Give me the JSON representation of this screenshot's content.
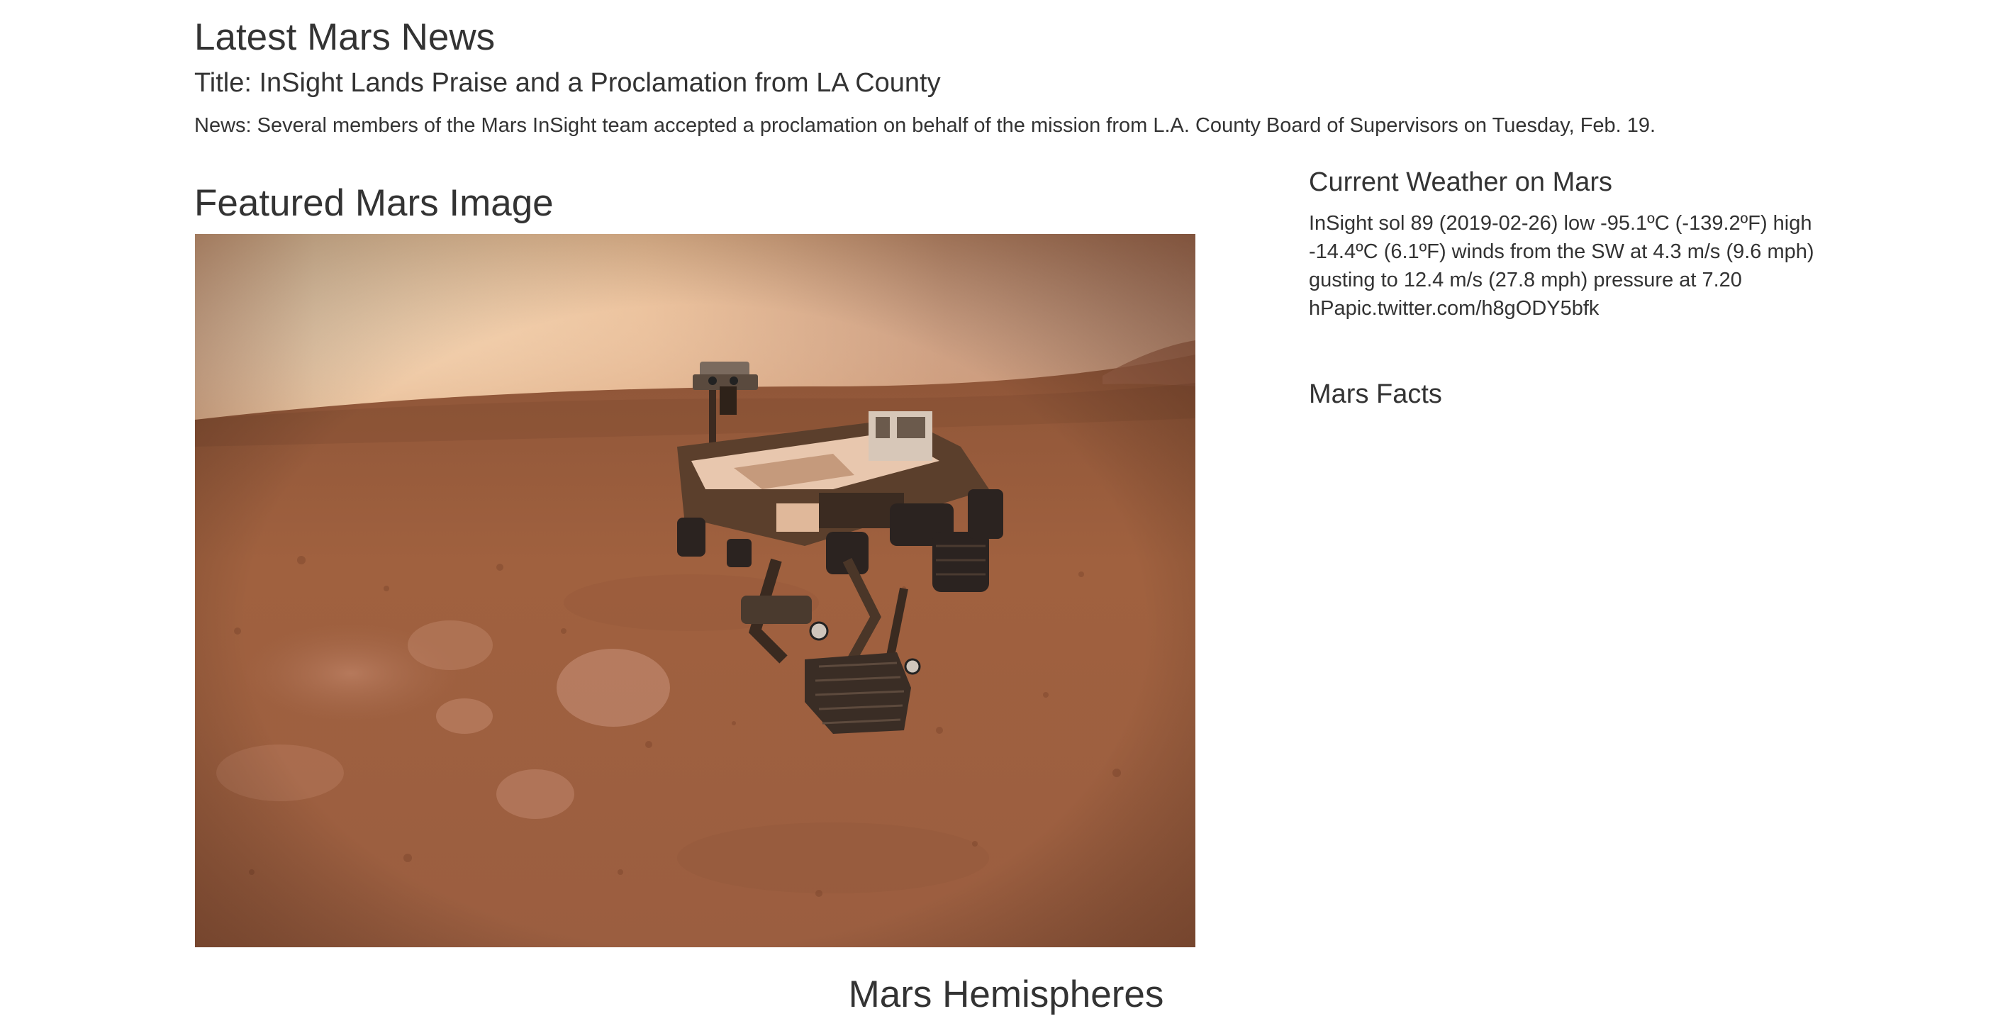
{
  "news": {
    "heading": "Latest Mars News",
    "title": "Title: InSight Lands Praise and a Proclamation from LA County",
    "paragraph": "News: Several members of the Mars InSight team accepted a proclamation on behalf of the mission from L.A. County Board of Supervisors on Tuesday, Feb. 19."
  },
  "featured": {
    "heading": "Featured Mars Image",
    "image_subject": "rover-selfie-on-mars-surface"
  },
  "weather": {
    "heading": "Current Weather on Mars",
    "text": "InSight sol 89 (2019-02-26) low -95.1ºC (-139.2ºF) high -14.4ºC (6.1ºF) winds from the SW at 4.3 m/s (9.6 mph) gusting to 12.4 m/s (27.8 mph) pressure at 7.20 hPapic.twitter.com/h8gODY5bfk"
  },
  "facts": {
    "heading": "Mars Facts"
  },
  "hemispheres": {
    "heading": "Mars Hemispheres"
  },
  "colors": {
    "text": "#333333",
    "background": "#ffffff",
    "mars_sky": "#e7b48c",
    "mars_ground": "#9b5a3f"
  }
}
